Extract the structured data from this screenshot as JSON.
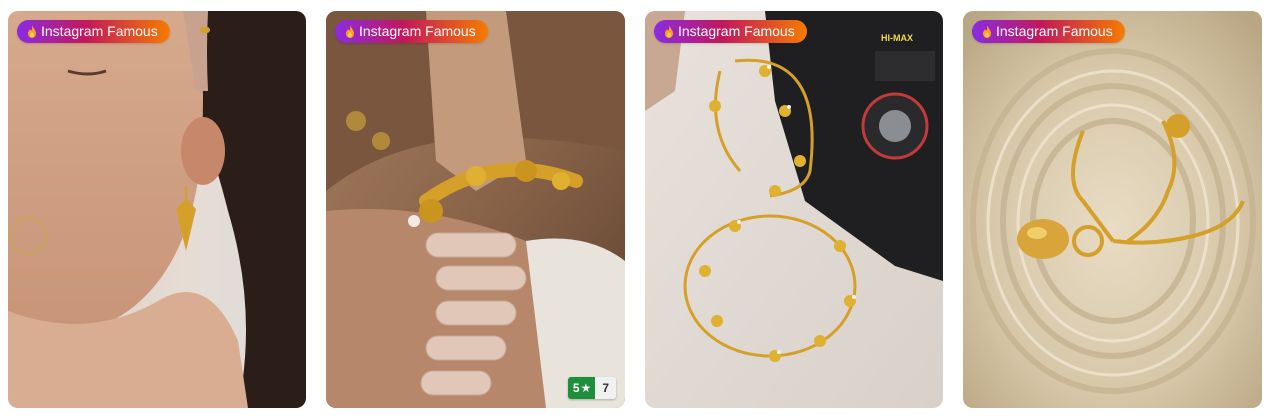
{
  "products": [
    {
      "badge_label": "Instagram Famous",
      "badge_icon": "flame-icon",
      "image_subject": "earring"
    },
    {
      "badge_label": "Instagram Famous",
      "badge_icon": "flame-icon",
      "image_subject": "bracelet",
      "rating": {
        "score": "5",
        "star": "★",
        "count": "7"
      }
    },
    {
      "badge_label": "Instagram Famous",
      "badge_icon": "flame-icon",
      "image_subject": "bangles"
    },
    {
      "badge_label": "Instagram Famous",
      "badge_icon": "flame-icon",
      "image_subject": "necklace"
    }
  ],
  "colors": {
    "badge_gradient_start": "#8a2be2",
    "badge_gradient_mid": "#c2185b",
    "badge_gradient_end": "#f57c00",
    "rating_green": "#1e8f3a",
    "gold": "#d4a02a"
  }
}
